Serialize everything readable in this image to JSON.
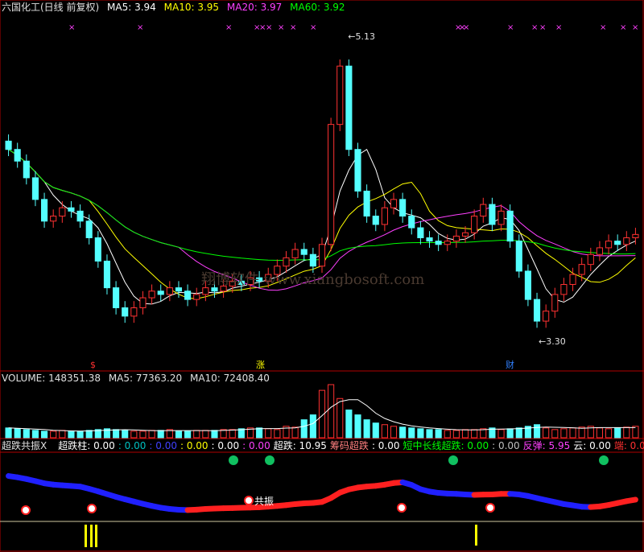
{
  "header": {
    "title": "六国化工(日线 前复权)",
    "ma5": "MA5: 3.94",
    "ma10": "MA10: 3.95",
    "ma20": "MA20: 3.97",
    "ma60": "MA60: 3.92"
  },
  "volume_header": {
    "volume": "VOLUME: 148351.38",
    "ma5": "MA5: 77363.20",
    "ma10": "MA10: 72408.40"
  },
  "indicator_header": {
    "name": "超跌共振X",
    "items": [
      {
        "text": "超跌柱: 0.00",
        "color": "#ffffff"
      },
      {
        "text": ": 0.00",
        "color": "#00c0c0"
      },
      {
        "text": ": 0.00",
        "color": "#4040ff"
      },
      {
        "text": ": 0.00",
        "color": "#ffff00"
      },
      {
        "text": ": 0.00",
        "color": "#ffffff"
      },
      {
        "text": ": 0.00",
        "color": "#ff40ff"
      },
      {
        "text": "超跌: 10.95",
        "color": "#ffffff"
      },
      {
        "text": "筹码超跌",
        "color": "#ff8080"
      },
      {
        "text": ": 0.00",
        "color": "#ffffff"
      },
      {
        "text": "短中长线超跌: 0.00",
        "color": "#00ff00"
      },
      {
        "text": ": 0.00",
        "color": "#c0c0c0"
      },
      {
        "text": "反弹: 5.95",
        "color": "#ff40ff"
      },
      {
        "text": "云: 0.00",
        "color": "#ffffff"
      },
      {
        "text": "端: 0.00",
        "color": "#ff3030"
      }
    ]
  },
  "annotations": {
    "high": "5.13",
    "low": "3.30",
    "marker_1": "$",
    "marker_2": "涨",
    "marker_3": "财",
    "resonance": "共振",
    "watermark": "翔博软件 www.xiangbosoft.com"
  },
  "colors": {
    "up": "#ff3232",
    "down": "#54ffff",
    "ma5": "#ffffff",
    "ma10": "#ffff00",
    "ma20": "#ff40ff",
    "ma60": "#00ff00",
    "panel_line": "#b00000"
  },
  "chart_data": [
    {
      "type": "candlestick",
      "title": "六国化工(日线 前复权)",
      "ylim": [
        3.15,
        5.25
      ],
      "annotated_high": 5.13,
      "annotated_low": 3.3,
      "close": [
        4.45,
        4.38,
        4.28,
        4.15,
        4.02,
        4.05,
        4.1,
        4.08,
        4.02,
        3.92,
        3.78,
        3.62,
        3.5,
        3.45,
        3.5,
        3.56,
        3.6,
        3.58,
        3.62,
        3.6,
        3.55,
        3.58,
        3.62,
        3.6,
        3.63,
        3.66,
        3.64,
        3.68,
        3.66,
        3.7,
        3.75,
        3.8,
        3.85,
        3.82,
        3.75,
        3.88,
        4.6,
        4.95,
        4.45,
        4.2,
        4.05,
        4.0,
        4.1,
        4.15,
        4.05,
        3.98,
        3.92,
        3.9,
        3.88,
        3.9,
        3.93,
        3.95,
        4.05,
        4.12,
        4.0,
        4.08,
        3.9,
        3.72,
        3.55,
        3.42,
        3.48,
        3.58,
        3.64,
        3.7,
        3.76,
        3.82,
        3.86,
        3.9,
        3.88,
        3.92,
        3.94
      ],
      "series": [
        {
          "name": "MA5",
          "value": 3.94
        },
        {
          "name": "MA10",
          "value": 3.95
        },
        {
          "name": "MA20",
          "value": 3.97
        },
        {
          "name": "MA60",
          "value": 3.92
        }
      ]
    },
    {
      "type": "bar",
      "title": "VOLUME",
      "volume": 148351.38,
      "ma5": 77363.2,
      "ma10": 72408.4,
      "values": [
        12,
        11,
        10,
        9,
        8,
        8,
        9,
        8,
        8,
        9,
        10,
        11,
        10,
        9,
        8,
        8,
        9,
        9,
        10,
        8,
        8,
        9,
        9,
        9,
        10,
        10,
        11,
        12,
        12,
        11,
        10,
        14,
        13,
        22,
        28,
        58,
        65,
        48,
        34,
        28,
        22,
        18,
        16,
        14,
        13,
        12,
        11,
        10,
        10,
        9,
        9,
        10,
        10,
        11,
        12,
        10,
        11,
        12,
        14,
        16,
        12,
        10,
        11,
        12,
        13,
        14,
        12,
        11,
        12,
        13,
        14
      ]
    }
  ]
}
